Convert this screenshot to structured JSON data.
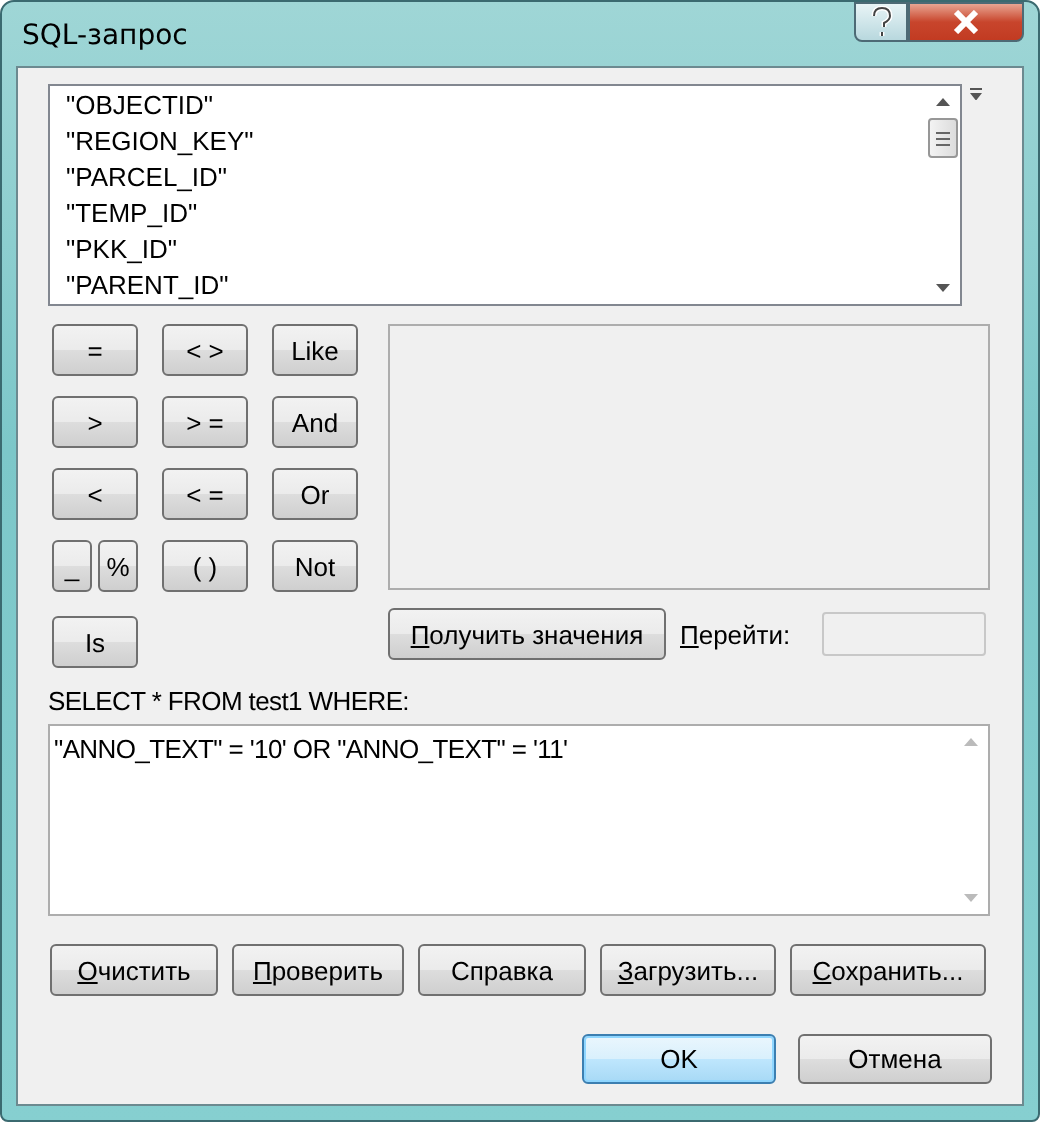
{
  "window": {
    "title": "SQL-запрос"
  },
  "fields": [
    "\"OBJECTID\"",
    "\"REGION_KEY\"",
    "\"PARCEL_ID\"",
    "\"TEMP_ID\"",
    "\"PKK_ID\"",
    "\"PARENT_ID\""
  ],
  "operators": [
    {
      "cells": [
        [
          "="
        ],
        [
          "< >"
        ],
        [
          "Like"
        ]
      ]
    },
    {
      "cells": [
        [
          ">"
        ],
        [
          "> ="
        ],
        [
          "And"
        ]
      ]
    },
    {
      "cells": [
        [
          "<"
        ],
        [
          "< ="
        ],
        [
          "Or"
        ]
      ]
    },
    {
      "cells": [
        [
          "_",
          "%"
        ],
        [
          "( )"
        ],
        [
          "Not"
        ]
      ]
    },
    {
      "cells": [
        [
          "Is"
        ]
      ]
    }
  ],
  "get_values_button": {
    "label": "Получить значения",
    "underline_first": true
  },
  "goto": {
    "label": "Перейти:",
    "underline_first": true
  },
  "query_label": "SELECT * FROM test1 WHERE:",
  "query": "\"ANNO_TEXT\" = '10' OR \"ANNO_TEXT\" = '11'",
  "actions": [
    {
      "label": "Очистить",
      "underline_first": true
    },
    {
      "label": "Проверить",
      "underline_first": true
    },
    {
      "label": "Справка",
      "underline_first": false
    },
    {
      "label": "Загрузить...",
      "underline_first": true
    },
    {
      "label": "Сохранить...",
      "underline_first": true
    }
  ],
  "dialog_buttons": [
    {
      "label": "OK",
      "default": true
    },
    {
      "label": "Отмена",
      "default": false
    }
  ]
}
